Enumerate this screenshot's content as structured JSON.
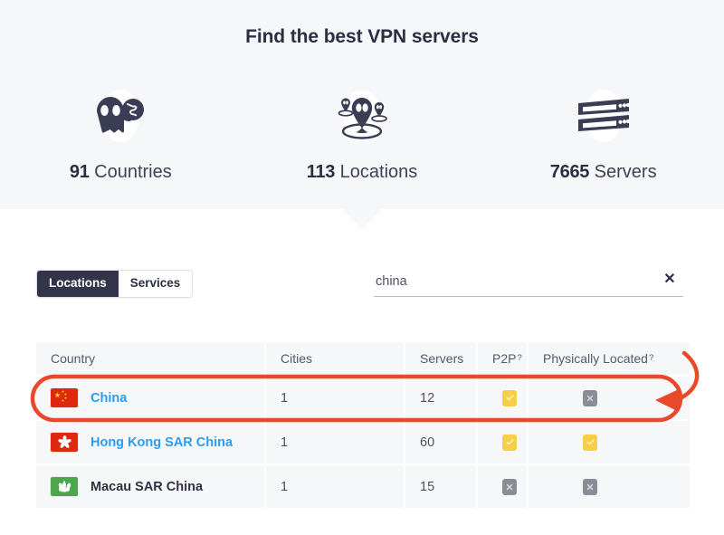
{
  "hero": {
    "title": "Find the best VPN servers",
    "stats": [
      {
        "value": "91",
        "label": "Countries",
        "icon": "ghost-globe-icon"
      },
      {
        "value": "113",
        "label": "Locations",
        "icon": "map-pins-icon"
      },
      {
        "value": "7665",
        "label": "Servers",
        "icon": "server-racks-icon"
      }
    ]
  },
  "controls": {
    "tabs": [
      {
        "label": "Locations",
        "active": true
      },
      {
        "label": "Services",
        "active": false
      }
    ],
    "search": {
      "value": "china",
      "placeholder": "Search",
      "clear_label": "✕"
    }
  },
  "table": {
    "columns": [
      {
        "label": "Country",
        "help": ""
      },
      {
        "label": "Cities",
        "help": ""
      },
      {
        "label": "Servers",
        "help": ""
      },
      {
        "label": "P2P",
        "help": "?"
      },
      {
        "label": "Physically Located",
        "help": "?"
      }
    ],
    "rows": [
      {
        "country": "China",
        "flag": "cn",
        "is_link": true,
        "cities": "1",
        "servers": "12",
        "p2p": "yes",
        "physically_located": "no",
        "highlighted": true
      },
      {
        "country": "Hong Kong SAR China",
        "flag": "hk",
        "is_link": true,
        "cities": "1",
        "servers": "60",
        "p2p": "yes",
        "physically_located": "yes",
        "highlighted": false
      },
      {
        "country": "Macau SAR China",
        "flag": "mo",
        "is_link": false,
        "cities": "1",
        "servers": "15",
        "p2p": "no",
        "physically_located": "no",
        "highlighted": false
      }
    ]
  },
  "annotation": {
    "color": "#e8492b",
    "shape": "rounded-rect-with-curved-arrow",
    "target_row": "China"
  },
  "colors": {
    "hero_bg": "#f6f7f9",
    "dark_navy": "#2c2e41",
    "link_blue": "#2c9cf0",
    "badge_yes": "#f7cf46",
    "badge_no": "#8a8d95",
    "annotation_red": "#e8492b",
    "cell_bg": "#f6f7f9"
  }
}
